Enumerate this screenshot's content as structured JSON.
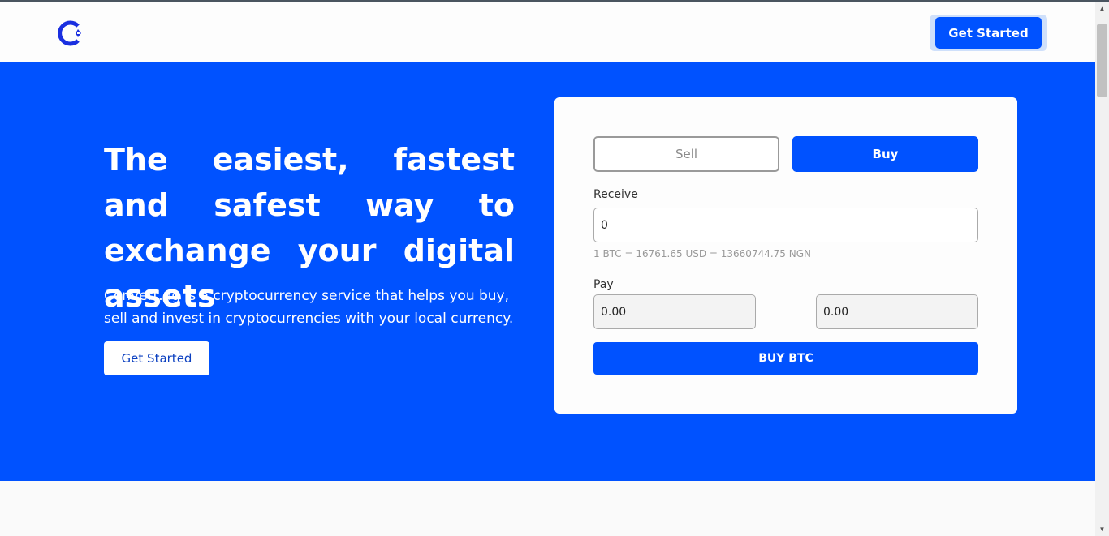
{
  "header": {
    "logo_icon": "convert-logo-icon",
    "cta_label": "Get Started"
  },
  "hero": {
    "title": "The easiest, fastest and safest way to exchange your digital assets",
    "subtitle": "Convert.ng is a cryptocurrency service that helps you buy, sell and invest in cryptocurrencies with your local currency.",
    "cta_label": "Get Started"
  },
  "exchange": {
    "tabs": [
      {
        "label": "Sell",
        "active": false
      },
      {
        "label": "Buy",
        "active": true
      }
    ],
    "receive_label": "Receive",
    "receive_value": "0",
    "rate_text": "1 BTC = 16761.65 USD = 13660744.75 NGN",
    "pay_label": "Pay",
    "pay_value_1": "0.00",
    "pay_value_2": "0.00",
    "submit_label": "BUY BTC"
  },
  "colors": {
    "brand": "#0052ff",
    "card_bg": "#fdfdfd"
  }
}
